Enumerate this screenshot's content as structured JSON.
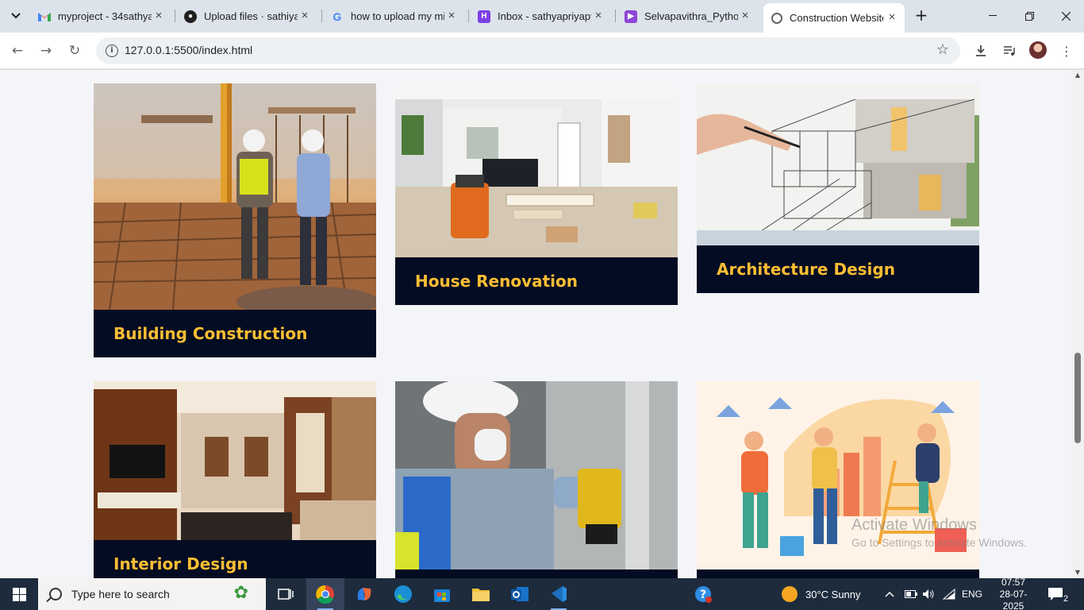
{
  "browser": {
    "tabs": [
      {
        "title": "myproject - 34sathya",
        "icon": "gmail-icon",
        "active": false
      },
      {
        "title": "Upload files · sathiyap",
        "icon": "github-icon",
        "active": false
      },
      {
        "title": "how to upload my mi",
        "icon": "google-icon",
        "active": false
      },
      {
        "title": "Inbox - sathyapriyapy",
        "icon": "mail-icon",
        "active": false
      },
      {
        "title": "Selvapavithra_Python",
        "icon": "video-icon",
        "active": false
      },
      {
        "title": "Construction Website",
        "icon": "globe-icon",
        "active": true
      }
    ],
    "url": "127.0.0.1:5500/index.html"
  },
  "services": {
    "cards": [
      {
        "title": "Building Construction",
        "image": "construction-site-photo"
      },
      {
        "title": "House Renovation",
        "image": "renovation-room-photo"
      },
      {
        "title": "Architecture Design",
        "image": "architecture-sketch-photo"
      },
      {
        "title": "Interior Design",
        "image": "living-room-interior-photo"
      },
      {
        "title": "",
        "image": "worker-drilling-door-photo"
      },
      {
        "title": "",
        "image": "painters-illustration"
      }
    ]
  },
  "watermark": {
    "line1": "Activate Windows",
    "line2": "Go to Settings to activate Windows."
  },
  "taskbar": {
    "search_placeholder": "Type here to search",
    "weather": "30°C  Sunny",
    "language": "ENG",
    "time": "07:57",
    "date": "28-07-2025",
    "notification_count": "2"
  },
  "colors": {
    "caption_bg": "#030c22",
    "caption_text": "#fdbe33",
    "page_bg": "#f4f5f8"
  }
}
